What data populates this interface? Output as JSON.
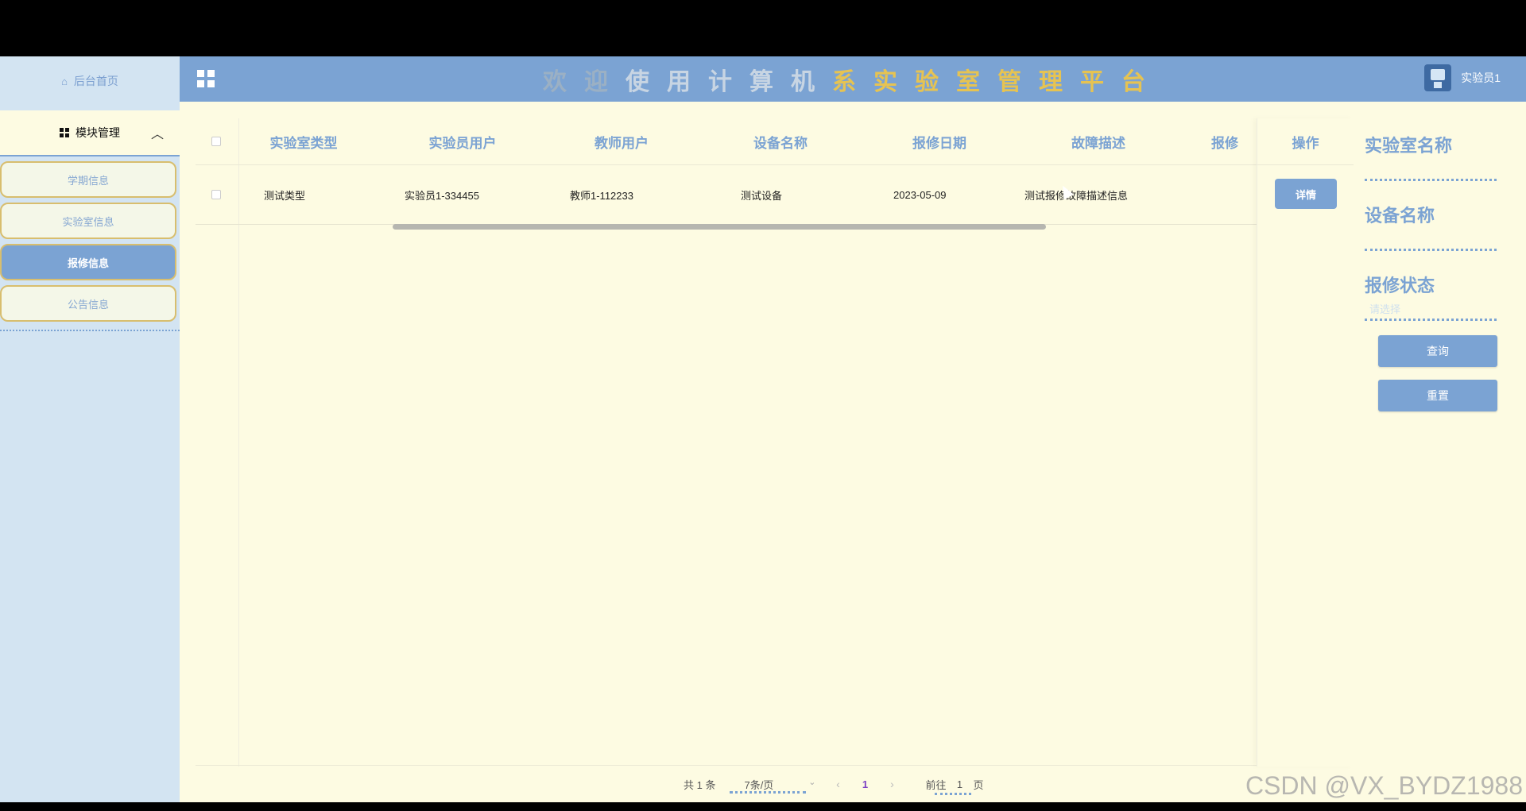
{
  "sidebar": {
    "home_label": "后台首页",
    "module_label": "模块管理",
    "items": [
      {
        "label": "学期信息",
        "active": false
      },
      {
        "label": "实验室信息",
        "active": false
      },
      {
        "label": "报修信息",
        "active": true
      },
      {
        "label": "公告信息",
        "active": false
      }
    ]
  },
  "header": {
    "title_part1": "欢迎",
    "title_part2": "使用计算机",
    "title_part3": "系实验室管理平台",
    "username": "实验员1"
  },
  "table": {
    "columns": [
      "实验室类型",
      "实验员用户",
      "教师用户",
      "设备名称",
      "报修日期",
      "故障描述",
      "报修"
    ],
    "action_column": "操作",
    "rows": [
      {
        "cells": [
          "测试类型",
          "实验员1-334455",
          "教师1-112233",
          "测试设备",
          "2023-05-09",
          "测试报修故障描述信息",
          ""
        ],
        "action_label": "详情"
      }
    ]
  },
  "pagination": {
    "total": "共 1 条",
    "page_size": "7条/页",
    "current_page": "1",
    "goto_prefix": "前往",
    "goto_value": "1",
    "goto_suffix": "页",
    "prev": "‹",
    "next": "›"
  },
  "search": {
    "lab_name_label": "实验室名称",
    "device_name_label": "设备名称",
    "repair_status_label": "报修状态",
    "repair_status_placeholder": "请选择",
    "query_button": "查询",
    "reset_button": "重置"
  },
  "watermark": "CSDN @VX_BYDZ1988",
  "colors": {
    "accent": "#7ba3d3",
    "background": "#fdfbe2",
    "sidebar": "#d3e4f2",
    "title_gold": "#e6c352"
  }
}
